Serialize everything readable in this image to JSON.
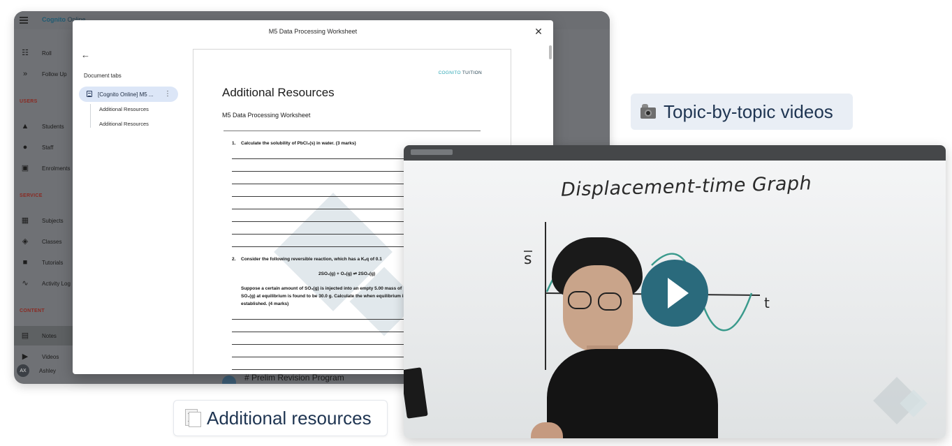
{
  "app": {
    "brand_prefix": "Cognito",
    "brand_suffix": "Online",
    "nav_top": [
      {
        "label": "Roll",
        "icon": "checklist-icon"
      },
      {
        "label": "Follow Up",
        "icon": "double-chevron-icon"
      }
    ],
    "sections": {
      "users": "USERS",
      "service": "SERVICE",
      "content": "CONTENT"
    },
    "users_items": [
      {
        "label": "Students",
        "icon": "graduation-cap-icon"
      },
      {
        "label": "Staff",
        "icon": "people-icon"
      },
      {
        "label": "Enrolments",
        "icon": "id-badge-icon"
      }
    ],
    "service_items": [
      {
        "label": "Subjects",
        "icon": "grid-icon"
      },
      {
        "label": "Classes",
        "icon": "classes-icon"
      },
      {
        "label": "Tutorials",
        "icon": "video-camera-icon"
      },
      {
        "label": "Activity Log",
        "icon": "trend-icon"
      }
    ],
    "content_items": [
      {
        "label": "Notes",
        "icon": "notes-icon",
        "active": true
      },
      {
        "label": "Videos",
        "icon": "play-box-icon"
      }
    ],
    "user": {
      "initials": "AX",
      "name": "Ashley"
    },
    "background_program": "# Prelim Revision Program"
  },
  "modal": {
    "title": "M5 Data Processing Worksheet",
    "document_tabs_heading": "Document tabs",
    "active_tab": "[Cognito Online] M5 ...",
    "subtabs": [
      "Additional Resources",
      "Additional Resources"
    ]
  },
  "document": {
    "brand_a": "COGNITO",
    "brand_b": "TUITION",
    "title": "Additional Resources",
    "subtitle": "M5 Data Processing Worksheet",
    "q1_number": "1.",
    "q1_text": "Calculate the solubility of PbCl₂(s) in water. (3 marks)",
    "q2_number": "2.",
    "q2_text": "Consider the following reversible reaction, which has a Kₑq of 0.1",
    "equation": "2SO₂(g) + O₂(g) ⇌ 2SO₃(g)",
    "q2_body": "Suppose a certain amount of SO₃(g) is injected into an empty 5.00 mass of SO₂(g) at equilibrium is found to be 30.0 g. Calculate the when equilibrium is established. (4 marks)"
  },
  "labels": {
    "topic_videos": "Topic-by-topic videos",
    "additional_resources": "Additional resources"
  },
  "video": {
    "whiteboard_title": "Displacement-time Graph",
    "axis_s": "s",
    "axis_t": "t"
  }
}
